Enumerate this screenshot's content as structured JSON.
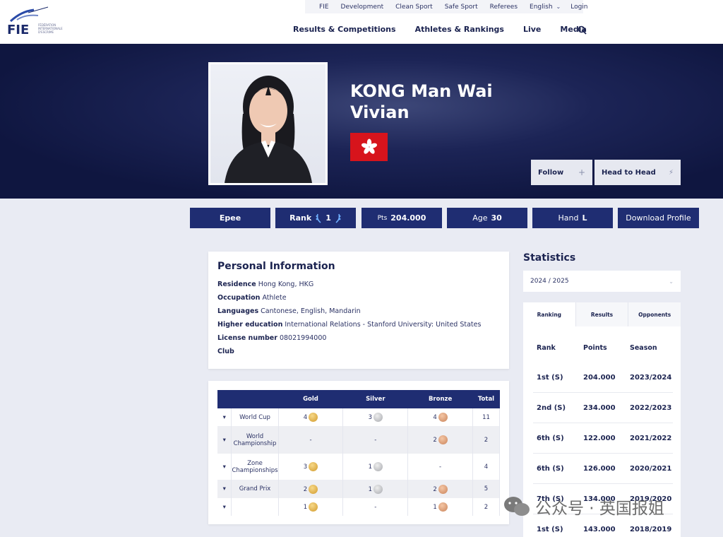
{
  "brand": {
    "logo_text": "FIE",
    "logo_sub": "FÉDÉRATION INTERNATIONALE D'ESCRIME"
  },
  "top_nav": [
    "FIE",
    "Development",
    "Clean Sport",
    "Safe Sport",
    "Referees",
    "English",
    "Login"
  ],
  "main_nav": [
    "Results & Competitions",
    "Athletes & Rankings",
    "Live",
    "Media"
  ],
  "athlete": {
    "name_line1": "KONG Man Wai",
    "name_line2": "Vivian",
    "flag": "Hong Kong"
  },
  "hero_buttons": {
    "follow": "Follow",
    "follow_icon": "+",
    "h2h": "Head to Head",
    "h2h_icon": "⚡"
  },
  "stats_bar": {
    "weapon": "Epee",
    "rank_label": "Rank",
    "rank_value": "1",
    "pts_label": "Pts",
    "pts_value": "204.000",
    "age_label": "Age",
    "age_value": "30",
    "hand_label": "Hand",
    "hand_value": "L",
    "download": "Download Profile"
  },
  "personal": {
    "title": "Personal Information",
    "rows": [
      {
        "label": "Residence",
        "value": "Hong Kong, HKG"
      },
      {
        "label": "Occupation",
        "value": "Athlete"
      },
      {
        "label": "Languages",
        "value": "Cantonese, English, Mandarin"
      },
      {
        "label": "Higher education",
        "value": "International Relations - Stanford University: United States"
      },
      {
        "label": "License number",
        "value": "08021994000"
      },
      {
        "label": "Club",
        "value": ""
      }
    ]
  },
  "medals": {
    "headers": [
      "",
      "",
      "Gold",
      "Silver",
      "Bronze",
      "Total"
    ],
    "rows": [
      {
        "event": "World Cup",
        "gold": "4",
        "silver": "3",
        "bronze": "4",
        "total": "11"
      },
      {
        "event": "World Championship",
        "gold": "-",
        "silver": "-",
        "bronze": "2",
        "total": "2"
      },
      {
        "event": "Zone Championships",
        "gold": "3",
        "silver": "1",
        "bronze": "-",
        "total": "4"
      },
      {
        "event": "Grand Prix",
        "gold": "2",
        "silver": "1",
        "bronze": "2",
        "total": "5"
      },
      {
        "event": "",
        "gold": "1",
        "silver": "-",
        "bronze": "1",
        "total": "2"
      }
    ]
  },
  "statistics": {
    "title": "Statistics",
    "season": "2024 / 2025",
    "tabs": [
      "Ranking",
      "Results",
      "Opponents"
    ],
    "headers": [
      "Rank",
      "Points",
      "Season"
    ],
    "rows": [
      {
        "rank": "1st (S)",
        "points": "204.000",
        "season": "2023/2024"
      },
      {
        "rank": "2nd (S)",
        "points": "234.000",
        "season": "2022/2023"
      },
      {
        "rank": "6th (S)",
        "points": "122.000",
        "season": "2021/2022"
      },
      {
        "rank": "6th (S)",
        "points": "126.000",
        "season": "2020/2021"
      },
      {
        "rank": "7th (S)",
        "points": "134.000",
        "season": "2019/2020"
      },
      {
        "rank": "1st (S)",
        "points": "143.000",
        "season": "2018/2019"
      }
    ]
  },
  "watermark": "公众号 · 英国报姐"
}
